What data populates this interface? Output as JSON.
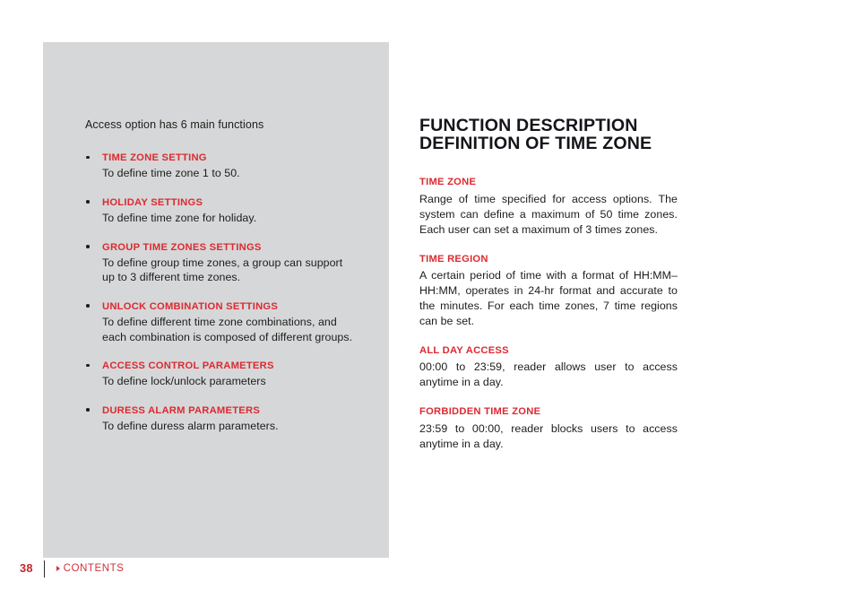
{
  "page": {
    "number": "38",
    "background_color": "#ffffff",
    "panel_color": "#d6d7d8",
    "accent_color": "#dc2a30",
    "text_color": "#1d1d1b"
  },
  "left_column": {
    "intro": "Access option has 6 main functions",
    "items": [
      {
        "title": "TIME ZONE SETTING",
        "body": "To define time zone 1 to 50."
      },
      {
        "title": "HOLIDAY SETTINGS",
        "body": "To define time zone for holiday."
      },
      {
        "title": "GROUP TIME ZONES SETTINGS",
        "body": "To define group time zones, a group can support up to 3 different time zones."
      },
      {
        "title": "UNLOCK COMBINATION SETTINGS",
        "body": "To define different time zone combinations, and each combination is composed of different groups."
      },
      {
        "title": "ACCESS CONTROL PARAMETERS",
        "body": "To define lock/unlock parameters"
      },
      {
        "title": "DURESS ALARM PARAMETERS",
        "body": "To define duress alarm parameters."
      }
    ]
  },
  "right_column": {
    "heading_line1": "FUNCTION DESCRIPTION",
    "heading_line2": "DEFINITION OF TIME ZONE",
    "sections": [
      {
        "title": "TIME ZONE",
        "body": "Range of time specified for access options. The system can define a maximum of 50 time zones. Each user can set a maximum of 3 times zones."
      },
      {
        "title": "TIME REGION",
        "body": "A certain period of time with a format of HH:MM–HH:MM, operates in 24-hr format and accurate to the minutes. For each time zones, 7 time regions can be set."
      },
      {
        "title": "ALL DAY ACCESS",
        "body": "00:00 to 23:59, reader allows user to access anytime in a day."
      },
      {
        "title": "FORBIDDEN TIME ZONE",
        "body": "23:59 to 00:00, reader blocks users to access anytime in a day."
      }
    ]
  },
  "footer": {
    "page_number": "38",
    "contents_label": "CONTENTS",
    "contents_icon": "triangle-right-icon"
  }
}
